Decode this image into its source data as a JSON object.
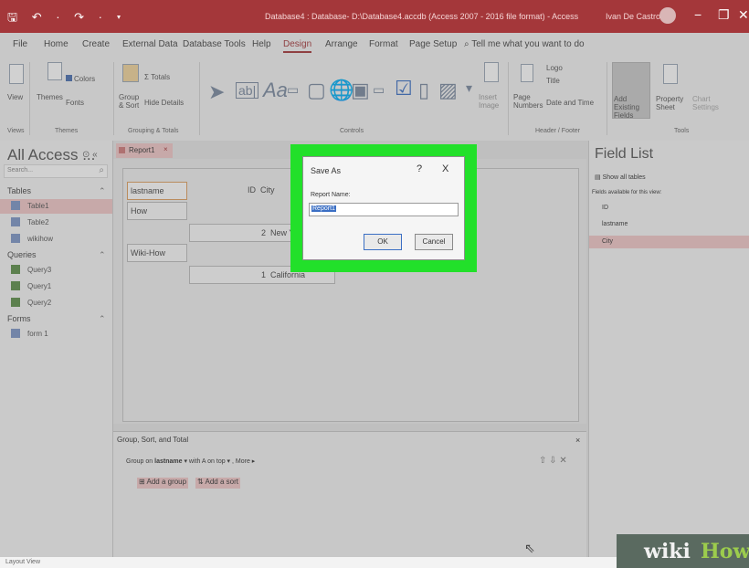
{
  "titlebar": {
    "qat": "🖫 ↶ · ↷ · ▾",
    "title": "Database4 : Database- D:\\Database4.accdb (Access 2007 - 2016 file format) - Access",
    "user": "Ivan De Castro",
    "minimize": "−",
    "restore": "❐",
    "close": "✕"
  },
  "ribbon": {
    "tabs": [
      "File",
      "Home",
      "Create",
      "External Data",
      "Database Tools",
      "Help",
      "Design",
      "Arrange",
      "Format",
      "Page Setup"
    ],
    "tell_me": "Tell me what you want to do",
    "view": {
      "label": "View",
      "group": "Views"
    },
    "themes": {
      "themes": "Themes",
      "colors": "Colors",
      "fonts": "Fonts",
      "group": "Themes"
    },
    "grouping": {
      "group_sort": "Group & Sort",
      "totals": "Totals",
      "hide_details": "Hide Details",
      "group": "Grouping & Totals"
    },
    "controls": {
      "group": "Controls",
      "insert_image": "Insert Image"
    },
    "header_footer": {
      "page_numbers": "Page Numbers",
      "logo": "Logo",
      "title": "Title",
      "date_time": "Date and Time",
      "group": "Header / Footer"
    },
    "tools": {
      "add_existing": "Add Existing Fields",
      "property_sheet": "Property Sheet",
      "chart_settings": "Chart Settings",
      "group": "Tools"
    }
  },
  "nav": {
    "title": "All Access ...",
    "search_placeholder": "Search...",
    "sections": [
      {
        "label": "Tables",
        "items": [
          "Table1",
          "Table2",
          "wikihow"
        ]
      },
      {
        "label": "Queries",
        "items": [
          "Query3",
          "Query1",
          "Query2"
        ]
      },
      {
        "label": "Forms",
        "items": [
          "form 1"
        ]
      }
    ]
  },
  "document": {
    "tab_label": "Report1",
    "cells": {
      "lastname_label": "lastname",
      "city_label": "City",
      "id_label": "ID",
      "row1_name": "How",
      "row1_id": "2",
      "row1_city": "New York",
      "row2_name": "Wiki-How",
      "row2_id": "1",
      "row2_city": "California"
    }
  },
  "group_pane": {
    "title": "Group, Sort, and Total",
    "group_on": "Group on",
    "field": "lastname",
    "order": "with A on top",
    "more": "More",
    "add_group": "Add a group",
    "add_sort": "Add a sort"
  },
  "field_list": {
    "title": "Field List",
    "show_all": "Show all tables",
    "available": "Fields available for this view:",
    "fields": [
      "ID",
      "lastname",
      "City"
    ]
  },
  "status": {
    "text": "Layout View"
  },
  "dialog": {
    "title": "Save As",
    "help": "?",
    "close": "X",
    "label": "Report Name:",
    "value": "Report1",
    "ok": "OK",
    "cancel": "Cancel"
  },
  "watermark": {
    "wiki": "wiki",
    "how": "How"
  },
  "colors": {
    "accent": "#a4373a",
    "highlight": "#22e02a"
  }
}
